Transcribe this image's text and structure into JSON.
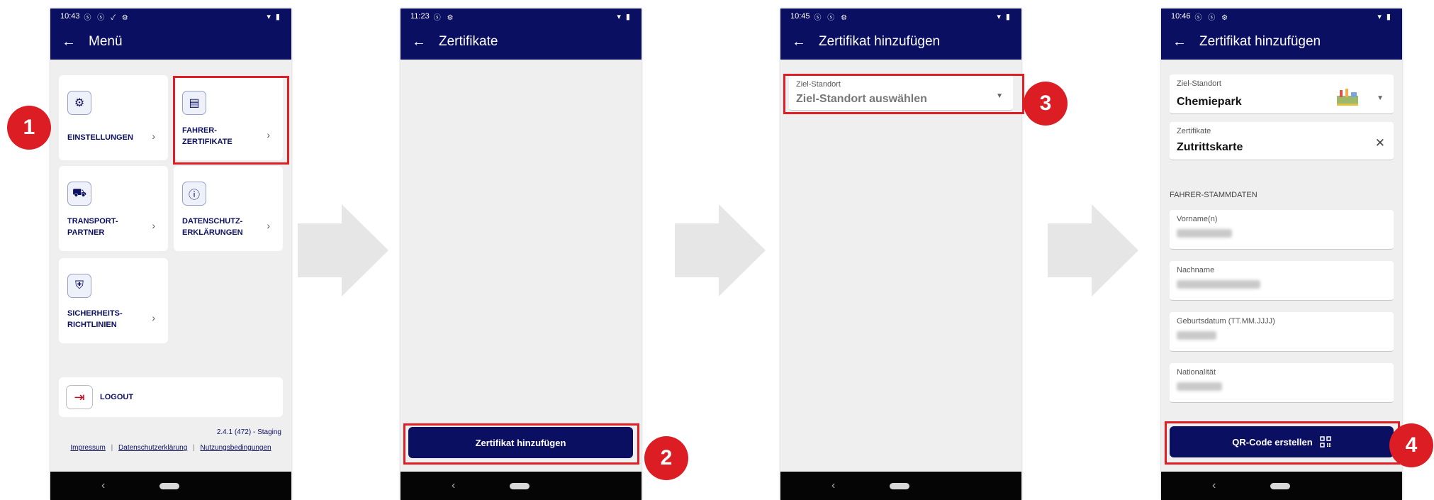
{
  "colors": {
    "brand": "#0b0f62",
    "accent_red": "#dc1d23",
    "background": "#efefef",
    "arrow": "#e6e6e6"
  },
  "screen1": {
    "status": {
      "time": "10:43",
      "icons": "ⓢ ⓢ ✓ ⚙",
      "right": "▾ ▮"
    },
    "appbar": {
      "back_icon": "arrow-left-icon",
      "title": "Menü"
    },
    "tiles": [
      {
        "icon": "gear-icon",
        "glyph": "⚙",
        "label": "EINSTELLUNGEN"
      },
      {
        "icon": "certificate-icon",
        "glyph": "▤",
        "label": "FAHRER-\nZERTIFIKATE"
      },
      {
        "icon": "truck-icon",
        "glyph": "⛟",
        "label": "TRANSPORT-\nPARTNER"
      },
      {
        "icon": "shield-info-icon",
        "glyph": "ⓘ",
        "label": "DATENSCHUTZ-\nERKLÄRUNGEN"
      },
      {
        "icon": "shield-icon",
        "glyph": "⛨",
        "label": "SICHERHEITS-\nRICHTLINIEN"
      }
    ],
    "chevron": "›",
    "logout": {
      "icon": "logout-icon",
      "glyph": "⇥",
      "label": "LOGOUT"
    },
    "version": "2.4.1 (472) - Staging",
    "links": {
      "impressum": "Impressum",
      "datenschutz": "Datenschutzerklärung",
      "nutzung": "Nutzungsbedingungen",
      "separator": "|"
    }
  },
  "screen2": {
    "status": {
      "time": "11:23",
      "icons": "ⓢ ⚙",
      "right": "▾ ▮"
    },
    "appbar": {
      "title": "Zertifikate"
    },
    "button": "Zertifikat hinzufügen"
  },
  "screen3": {
    "status": {
      "time": "10:45",
      "icons": "ⓢ ⓢ ⚙",
      "right": "▾ ▮"
    },
    "appbar": {
      "title": "Zertifikat hinzufügen"
    },
    "field": {
      "label": "Ziel-Standort",
      "placeholder": "Ziel-Standort auswählen"
    }
  },
  "screen4": {
    "status": {
      "time": "10:46",
      "icons": "ⓢ ⓢ ⚙",
      "right": "▾ ▮"
    },
    "appbar": {
      "title": "Zertifikat hinzufügen"
    },
    "site": {
      "label": "Ziel-Standort",
      "value": "Chemiepark"
    },
    "cert": {
      "label": "Zertifikate",
      "value": "Zutrittskarte",
      "clear": "✕"
    },
    "section": "FAHRER-STAMMDATEN",
    "fields": [
      {
        "label": "Vorname(n)"
      },
      {
        "label": "Nachname"
      },
      {
        "label": "Geburtsdatum (TT.MM.JJJJ)"
      },
      {
        "label": "Nationalität"
      }
    ],
    "button": "QR-Code erstellen",
    "button_icon": "qr-code-icon"
  },
  "steps": [
    "1",
    "2",
    "3",
    "4"
  ]
}
